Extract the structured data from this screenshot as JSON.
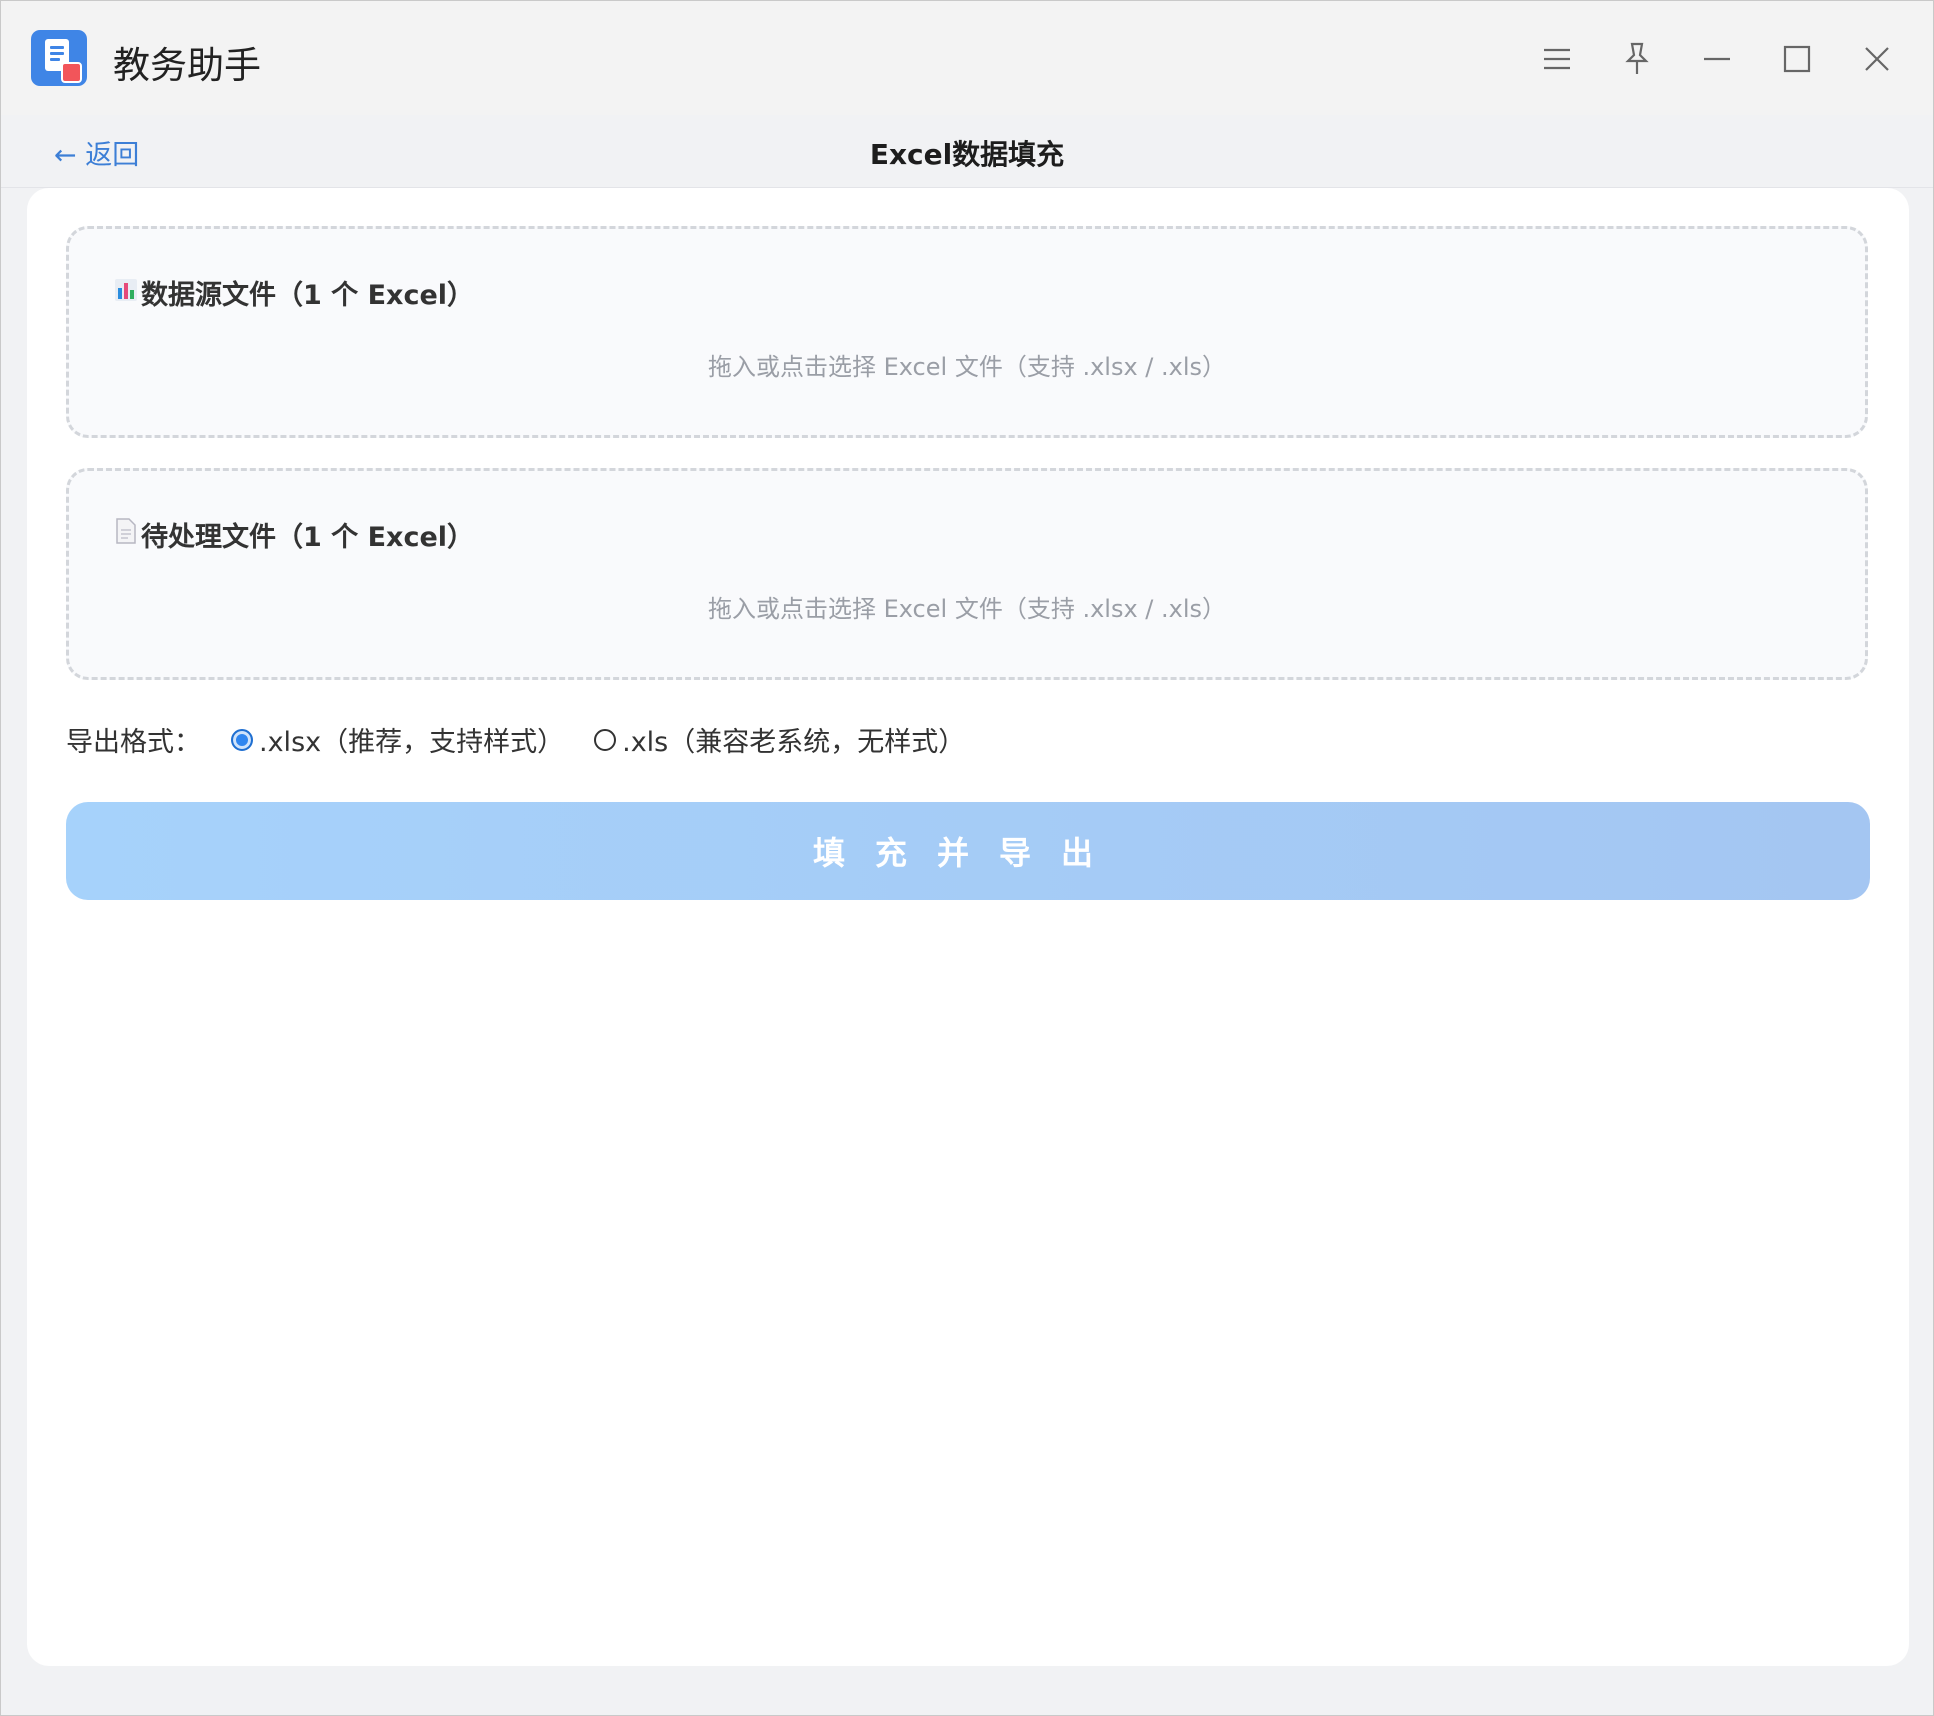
{
  "app": {
    "title": "教务助手"
  },
  "window_controls": {
    "menu_icon": "menu-icon",
    "pin_icon": "pin-icon",
    "minimize_icon": "minimize-icon",
    "maximize_icon": "maximize-icon",
    "close_icon": "close-icon"
  },
  "nav": {
    "back_label": "← 返回",
    "page_title": "Excel数据填充"
  },
  "source_box": {
    "icon": "chart-icon",
    "title": "数据源文件（1 个 Excel）",
    "hint": "拖入或点击选择 Excel 文件（支持 .xlsx / .xls）"
  },
  "target_box": {
    "icon": "document-icon",
    "title": "待处理文件（1 个 Excel）",
    "hint": "拖入或点击选择 Excel 文件（支持 .xlsx / .xls）"
  },
  "export_format": {
    "label": "导出格式：",
    "options": [
      {
        "label": ".xlsx（推荐，支持样式）",
        "selected": true
      },
      {
        "label": ".xls（兼容老系统，无样式）",
        "selected": false
      }
    ]
  },
  "action": {
    "button_label": "填充并导出"
  },
  "colors": {
    "accent": "#3d7fd6",
    "button_start": "#a6d2fb",
    "button_end": "#a4c6f2"
  }
}
